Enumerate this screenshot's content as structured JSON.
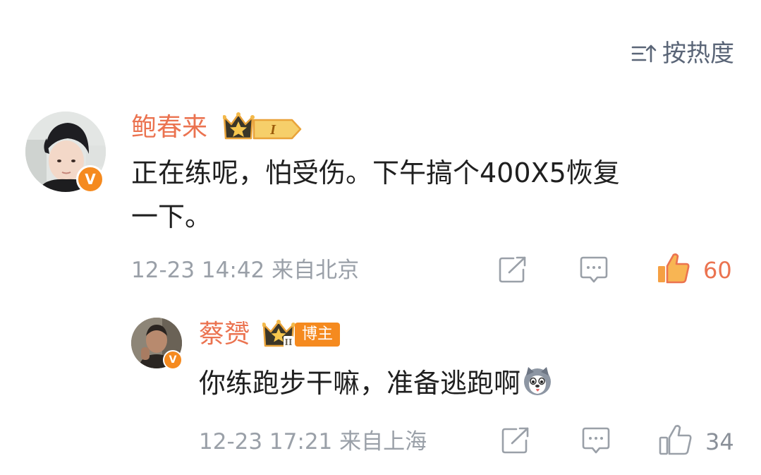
{
  "sort": {
    "label": "按热度",
    "icon": "sort-icon"
  },
  "colors": {
    "name": "#eb7350",
    "meta": "#9aa0a8",
    "like_active": "#eb7350",
    "badge_orange": "#f58a1f"
  },
  "comments": [
    {
      "author": "鲍春来",
      "level_badge": "I",
      "verified_badge": "V",
      "text_line1": "正在练呢，怕受伤。下午搞个400X5恢复",
      "text_line2": "一下。",
      "time": "12-23 14:42",
      "location": "来自北京",
      "likes": "60",
      "liked": true
    },
    {
      "author": "蔡赟",
      "level_badge": "II",
      "role_tag": "博主",
      "verified_badge": "V",
      "text": "你练跑步干嘛，准备逃跑啊",
      "emoji": "husky-emoji",
      "time": "12-23 17:21",
      "location": "来自上海",
      "likes": "34",
      "liked": false
    }
  ]
}
